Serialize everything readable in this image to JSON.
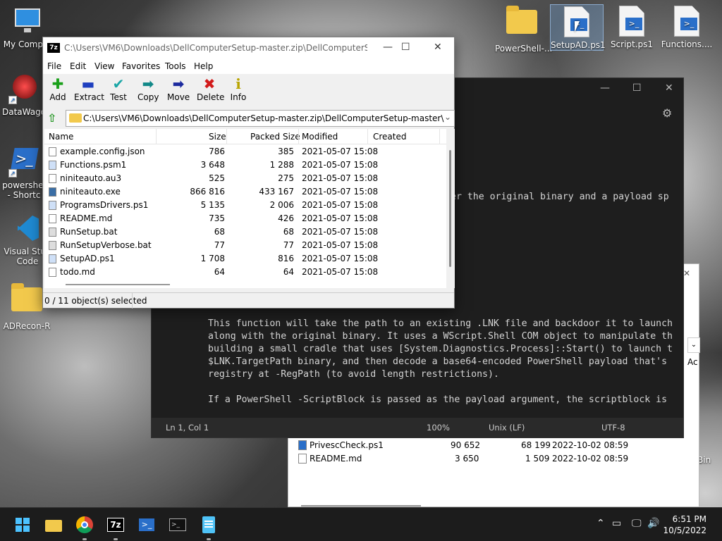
{
  "desktop": {
    "left_icons": [
      {
        "label": "My Comput",
        "icon": "monitor-icon"
      },
      {
        "label": "DataWago",
        "icon": "datawagon-icon"
      },
      {
        "label": "powershel\n- Shortc",
        "icon": "powershell-icon"
      },
      {
        "label": "Visual Stud\nCode",
        "icon": "vscode-icon"
      },
      {
        "label": "ADRecon-R",
        "icon": "folder-icon"
      }
    ],
    "top_icons": [
      {
        "label": "PowerShell-...",
        "icon": "folder-icon"
      },
      {
        "label": "SetupAD.ps1",
        "icon": "ps1-file-icon"
      },
      {
        "label": "Script.ps1",
        "icon": "ps1-file-icon"
      },
      {
        "label": "Functions....",
        "icon": "ps1-file-icon"
      }
    ],
    "right_edge_label": "Bin"
  },
  "zip_window": {
    "title": "C:\\Users\\VM6\\Downloads\\DellComputerSetup-master.zip\\DellComputerSetu...",
    "menu": [
      "File",
      "Edit",
      "View",
      "Favorites",
      "Tools",
      "Help"
    ],
    "toolbar": [
      {
        "label": "Add",
        "icon": "plus-icon",
        "color": "#1aa01a",
        "glyph": "✚"
      },
      {
        "label": "Extract",
        "icon": "minus-icon",
        "color": "#1e3fbf",
        "glyph": "▬"
      },
      {
        "label": "Test",
        "icon": "test-check-icon",
        "color": "#1aa6a6",
        "glyph": "✔"
      },
      {
        "label": "Copy",
        "icon": "copy-arrow-icon",
        "color": "#118888",
        "glyph": "➡"
      },
      {
        "label": "Move",
        "icon": "move-arrow-icon",
        "color": "#1b2a9e",
        "glyph": "➡"
      },
      {
        "label": "Delete",
        "icon": "delete-x-icon",
        "color": "#d21a1a",
        "glyph": "✖"
      },
      {
        "label": "Info",
        "icon": "info-icon",
        "color": "#c8b400",
        "glyph": "i"
      }
    ],
    "path": "C:\\Users\\VM6\\Downloads\\DellComputerSetup-master.zip\\DellComputerSetup-master\\",
    "columns": [
      "Name",
      "Size",
      "Packed Size",
      "Modified",
      "Created"
    ],
    "files": [
      {
        "name": "example.config.json",
        "size": "786",
        "packed": "385",
        "modified": "2021-05-07 15:08"
      },
      {
        "name": "Functions.psm1",
        "size": "3 648",
        "packed": "1 288",
        "modified": "2021-05-07 15:08"
      },
      {
        "name": "niniteauto.au3",
        "size": "525",
        "packed": "275",
        "modified": "2021-05-07 15:08"
      },
      {
        "name": "niniteauto.exe",
        "size": "866 816",
        "packed": "433 167",
        "modified": "2021-05-07 15:08"
      },
      {
        "name": "ProgramsDrivers.ps1",
        "size": "5 135",
        "packed": "2 006",
        "modified": "2021-05-07 15:08"
      },
      {
        "name": "README.md",
        "size": "735",
        "packed": "426",
        "modified": "2021-05-07 15:08"
      },
      {
        "name": "RunSetup.bat",
        "size": "68",
        "packed": "68",
        "modified": "2021-05-07 15:08"
      },
      {
        "name": "RunSetupVerbose.bat",
        "size": "77",
        "packed": "77",
        "modified": "2021-05-07 15:08"
      },
      {
        "name": "SetupAD.ps1",
        "size": "1 708",
        "packed": "816",
        "modified": "2021-05-07 15:08"
      },
      {
        "name": "todo.md",
        "size": "64",
        "packed": "64",
        "modified": "2021-05-07 15:08"
      }
    ],
    "status": "0 / 11 object(s) selected"
  },
  "editor_window": {
    "line_top": "er the original binary and a payload sp",
    "paragraph1": [
      "This function will take the path to an existing .LNK file and backdoor it to launch",
      "along with the original binary. It uses a WScript.Shell COM object to manipulate th",
      "building a small cradle that uses [System.Diagnostics.Process]::Start() to launch t",
      "$LNK.TargetPath binary, and then decode a base64-encoded PowerShell payload that's",
      "registry at -RegPath (to avoid length restrictions)."
    ],
    "paragraph2": "If a PowerShell -ScriptBlock is passed as the payload argument, the scriptblock is",
    "status": {
      "position": "Ln 1, Col 1",
      "zoom": "100%",
      "eol": "Unix (LF)",
      "encoding": "UTF-8"
    }
  },
  "bg_explorer": {
    "files": [
      {
        "name": "PrivescCheck.ps1",
        "size": "90 652",
        "packed": "68 199",
        "modified": "2022-10-02 08:59"
      },
      {
        "name": "README.md",
        "size": "3 650",
        "packed": "1 509",
        "modified": "2022-10-02 08:59"
      }
    ],
    "side_label": "Ac"
  },
  "taskbar": {
    "apps": [
      {
        "name": "start",
        "icon": "windows-start-icon"
      },
      {
        "name": "file-explorer",
        "icon": "folder-icon"
      },
      {
        "name": "chrome",
        "icon": "chrome-icon"
      },
      {
        "name": "7zip",
        "icon": "7zip-icon",
        "label": "7z"
      },
      {
        "name": "powershell",
        "icon": "powershell-icon"
      },
      {
        "name": "terminal",
        "icon": "terminal-icon"
      },
      {
        "name": "notepad",
        "icon": "notepad-icon"
      }
    ],
    "time": "6:51 PM",
    "date": "10/5/2022"
  }
}
